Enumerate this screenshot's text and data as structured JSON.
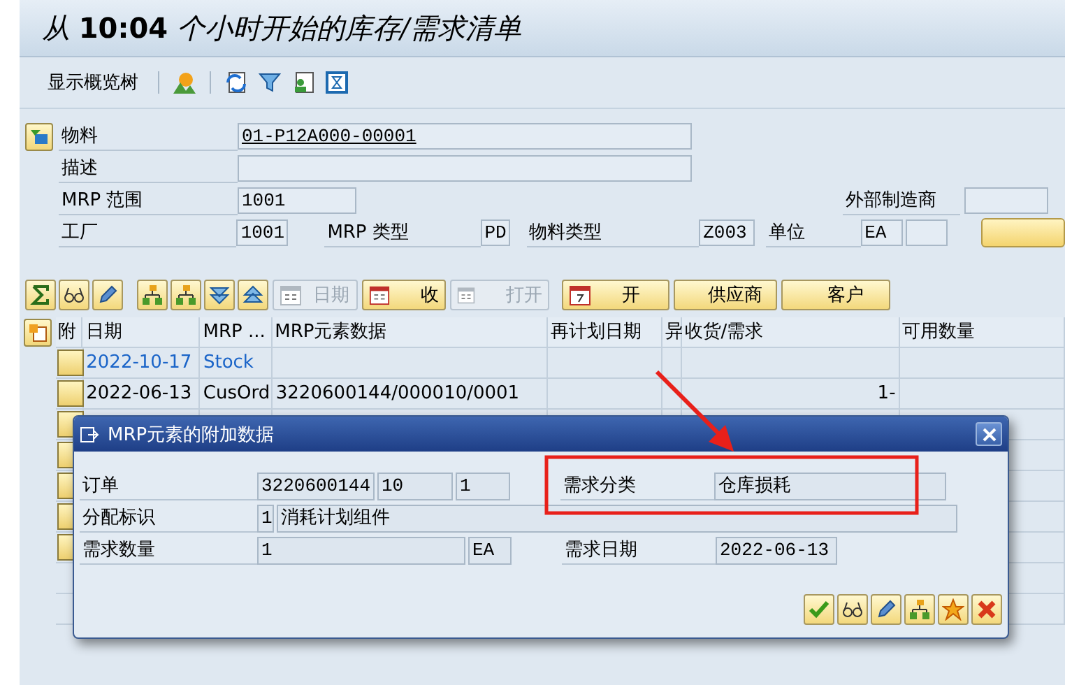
{
  "title": "从 **10:04** 个小时开始的库存/需求清单",
  "toolbar": {
    "overview_tree": "显示概览树"
  },
  "header": {
    "material": {
      "label": "物料",
      "value": "01-P12A000-00001"
    },
    "description": {
      "label": "描述"
    },
    "mrp_area": {
      "label": "MRP 范围",
      "value": "1001"
    },
    "external_manufacturer": {
      "label": "外部制造商"
    },
    "plant": {
      "label": "工厂",
      "value": "1001"
    },
    "mrp_type": {
      "label": "MRP 类型",
      "value": "PD"
    },
    "material_type": {
      "label": "物料类型",
      "value": "Z003"
    },
    "unit": {
      "label": "单位",
      "value": "EA"
    }
  },
  "buttons": [
    {
      "label": "日期",
      "disabled": true
    },
    {
      "label": "收",
      "disabled": false
    },
    {
      "label": "打开",
      "disabled": true
    },
    {
      "label": "开",
      "disabled": false
    },
    {
      "label": "供应商",
      "disabled": false
    },
    {
      "label": "客户",
      "disabled": false
    }
  ],
  "table": {
    "columns": [
      "附",
      "日期",
      "MRP ...",
      "MRP元素数据",
      "再计划日期",
      "异",
      "收货/需求",
      "可用数量"
    ],
    "rows": [
      {
        "kind": "stock",
        "date": "2022-10-17",
        "mrp_element": "Stock"
      },
      {
        "kind": "item",
        "date": "2022-06-13",
        "mrp_element": "CusOrd",
        "element_data": "3220600144/000010/0001",
        "receipt_requirement": "1-"
      },
      {
        "kind": "covered"
      },
      {
        "kind": "covered"
      },
      {
        "kind": "covered"
      },
      {
        "kind": "covered"
      },
      {
        "kind": "covered"
      }
    ]
  },
  "dialog": {
    "title": "MRP元素的附加数据",
    "order": {
      "label": "订单",
      "values": [
        "3220600144",
        "10",
        "1"
      ]
    },
    "requirement_class": {
      "label": "需求分类",
      "value": "仓库损耗"
    },
    "assignment": {
      "label": "分配标识",
      "code": "1",
      "text": "消耗计划组件"
    },
    "requirement_qty": {
      "label": "需求数量",
      "value": "1",
      "unit": "EA"
    },
    "requirement_date": {
      "label": "需求日期",
      "value": "2022-06-13"
    }
  }
}
